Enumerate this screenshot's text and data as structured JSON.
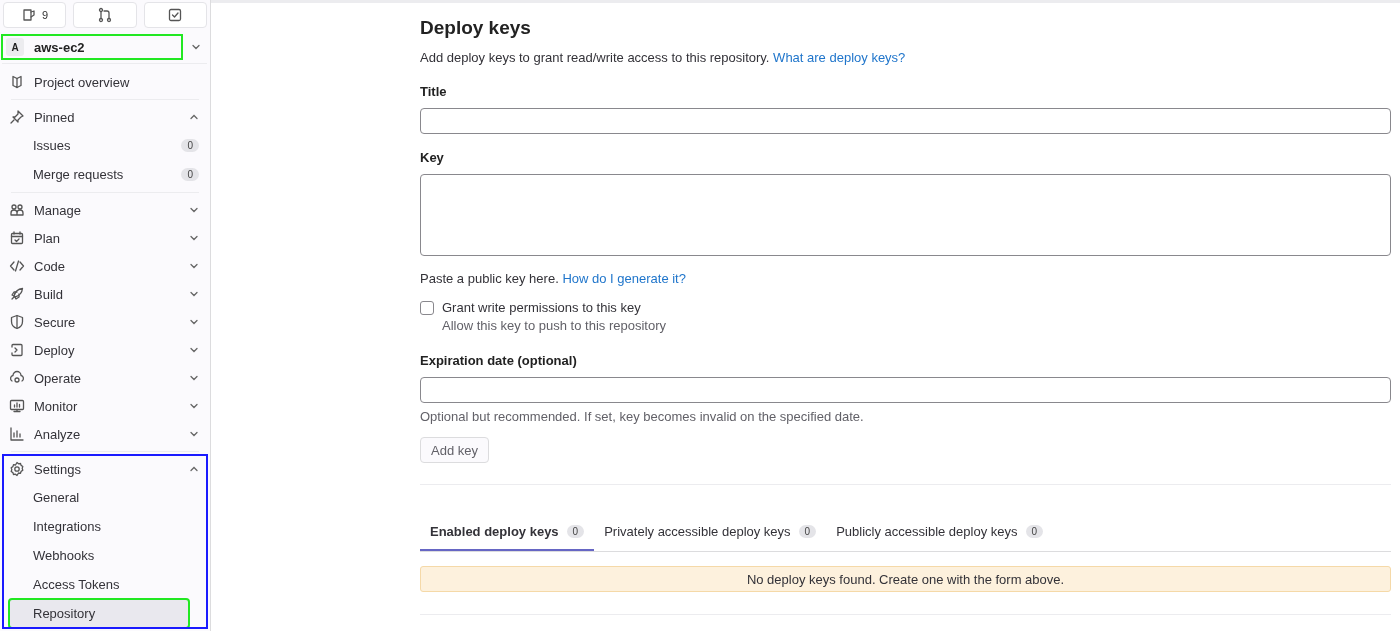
{
  "sidebar": {
    "top_buttons": [
      {
        "kind": "issues",
        "count": "9"
      },
      {
        "kind": "merge"
      },
      {
        "kind": "todo"
      }
    ],
    "project": {
      "avatar": "A",
      "name": "aws-ec2",
      "highlighted": true
    },
    "items": [
      {
        "kind": "overview",
        "label": "Project overview",
        "divider_after": true
      },
      {
        "kind": "pin",
        "label": "Pinned",
        "expanded": true,
        "divider_after": true,
        "children": [
          {
            "label": "Issues",
            "count": "0",
            "selected": false,
            "highlighted": false
          },
          {
            "label": "Merge requests",
            "count": "0",
            "selected": false,
            "highlighted": false
          }
        ]
      },
      {
        "kind": "manage",
        "label": "Manage",
        "expanded": false
      },
      {
        "kind": "plan",
        "label": "Plan",
        "expanded": false
      },
      {
        "kind": "code",
        "label": "Code",
        "expanded": false
      },
      {
        "kind": "build",
        "label": "Build",
        "expanded": false
      },
      {
        "kind": "secure",
        "label": "Secure",
        "expanded": false
      },
      {
        "kind": "deploy",
        "label": "Deploy",
        "expanded": false
      },
      {
        "kind": "operate",
        "label": "Operate",
        "expanded": false
      },
      {
        "kind": "monitor",
        "label": "Monitor",
        "expanded": false
      },
      {
        "kind": "analyze",
        "label": "Analyze",
        "expanded": false,
        "divider_after": true
      },
      {
        "kind": "settings",
        "label": "Settings",
        "expanded": true,
        "highlighted": true,
        "children": [
          {
            "label": "General",
            "selected": false,
            "highlighted": false
          },
          {
            "label": "Integrations",
            "selected": false,
            "highlighted": false
          },
          {
            "label": "Webhooks",
            "selected": false,
            "highlighted": false
          },
          {
            "label": "Access Tokens",
            "selected": false,
            "highlighted": false
          },
          {
            "label": "Repository",
            "selected": true,
            "highlighted": true
          }
        ]
      }
    ]
  },
  "main": {
    "title": "Deploy keys",
    "description": "Add deploy keys to grant read/write access to this repository.",
    "description_link": "What are deploy keys?",
    "title_label": "Title",
    "key_label": "Key",
    "key_hint": "Paste a public key here.",
    "key_hint_link": "How do I generate it?",
    "write_permission": {
      "label": "Grant write permissions to this key",
      "help": "Allow this key to push to this repository",
      "checked": false
    },
    "expiration_label": "Expiration date (optional)",
    "expiration_hint": "Optional but recommended. If set, key becomes invalid on the specified date.",
    "add_button": "Add key",
    "tabs": [
      {
        "label": "Enabled deploy keys",
        "count": "0",
        "selected": true
      },
      {
        "label": "Privately accessible deploy keys",
        "count": "0",
        "selected": false
      },
      {
        "label": "Publicly accessible deploy keys",
        "count": "0",
        "selected": false
      }
    ],
    "empty_message": "No deploy keys found. Create one with the form above."
  }
}
